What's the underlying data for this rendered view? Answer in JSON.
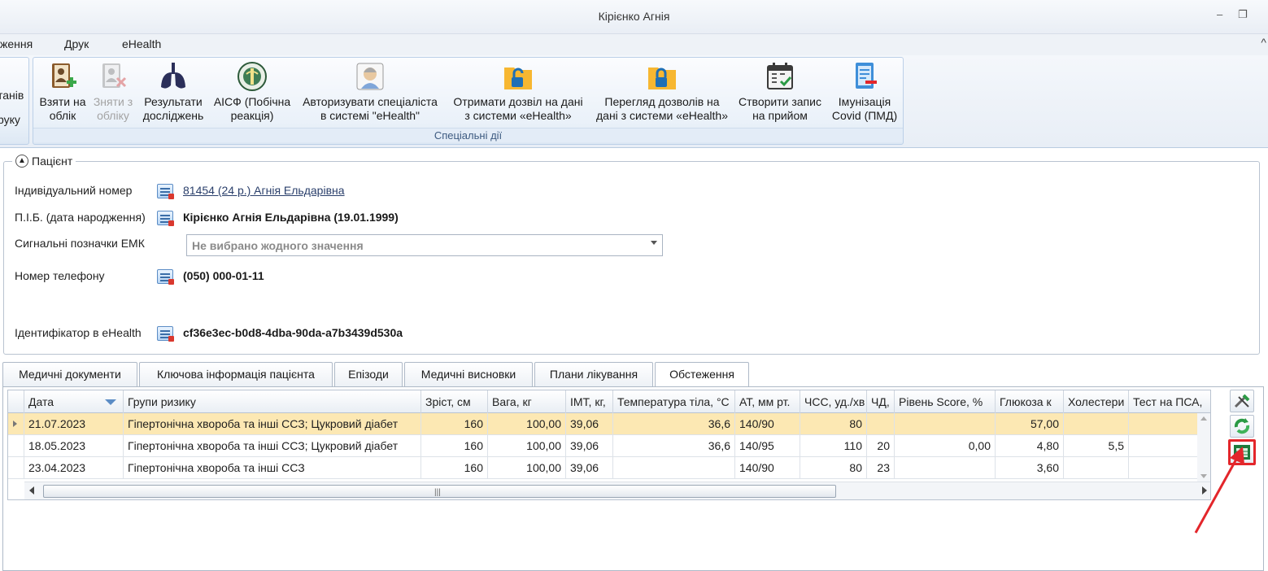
{
  "window": {
    "title": "Кірієнко Агнія",
    "minimize": "–",
    "restore": "❐"
  },
  "menu": {
    "items": [
      "ження",
      "Друк",
      "eHealth"
    ],
    "collapse": "^"
  },
  "ribbon": {
    "left_partial": {
      "line1": "танів",
      "line2": "руку"
    },
    "group_caption": "Спеціальні дії",
    "buttons": [
      {
        "line1": "Взяти на",
        "line2": "облік",
        "icon": "register-icon",
        "enabled": true
      },
      {
        "line1": "Зняти з",
        "line2": "обліку",
        "icon": "deregister-icon",
        "enabled": false
      },
      {
        "line1": "Результати",
        "line2": "досліджень",
        "icon": "lungs-icon",
        "enabled": true
      },
      {
        "line1": "АІСФ (Побічна",
        "line2": "реакція)",
        "icon": "emblem-icon",
        "enabled": true
      },
      {
        "line1": "Авторизувати спеціаліста",
        "line2": "в системі \"eHealth\"",
        "icon": "doctor-icon",
        "enabled": true
      },
      {
        "line1": "Отримати дозвіл на дані",
        "line2": "з системи «eHealth»",
        "icon": "unlock-folder-icon",
        "enabled": true
      },
      {
        "line1": "Перегляд дозволів на",
        "line2": "дані з системи «eHealth»",
        "icon": "lock-folder-icon",
        "enabled": true
      },
      {
        "line1": "Створити запис",
        "line2": "на прийом",
        "icon": "calendar-icon",
        "enabled": true
      },
      {
        "line1": "Імунізація",
        "line2": "Covid (ПМД)",
        "icon": "immunization-icon",
        "enabled": true
      }
    ]
  },
  "patient": {
    "legend": "Пацієнт",
    "id_label": "Індивідуальний номер",
    "id_value": "81454 (24 р.) Агнія Ельдарівна",
    "name_label": "П.І.Б. (дата народження)",
    "name_value": "Кірієнко Агнія Ельдарівна (19.01.1999)",
    "signal_label": "Сигнальні позначки ЕМК",
    "signal_placeholder": "Не вибрано жодного значення",
    "phone_label": "Номер телефону",
    "phone_value": "(050) 000-01-11",
    "ehealth_label": "Ідентифікатор в eHealth",
    "ehealth_value": "cf36e3ec-b0d8-4dba-90da-a7b3439d530a"
  },
  "tabs": [
    "Медичні документи",
    "Ключова інформація пацієнта",
    "Епізоди",
    "Медичні висновки",
    "Плани лікування",
    "Обстеження"
  ],
  "active_tab": "Обстеження",
  "table": {
    "columns": [
      "Дата",
      "Групи ризику",
      "Зріст, см",
      "Вага, кг",
      "ІМТ, кг,",
      "Температура тіла, °С",
      "АТ, мм рт.",
      "ЧСС, уд./хв",
      "ЧД,",
      "Рівень Score, %",
      "Глюкоза к",
      "Холестери",
      "Тест на ПСА,"
    ],
    "rows": [
      [
        "21.07.2023",
        "Гіпертонічна хвороба та інші ССЗ; Цукровий діабет",
        "160",
        "100,00",
        "39,06",
        "36,6",
        "140/90",
        "80",
        "",
        "",
        "57,00",
        "",
        ""
      ],
      [
        "18.05.2023",
        "Гіпертонічна хвороба та інші ССЗ; Цукровий діабет",
        "160",
        "100,00",
        "39,06",
        "36,6",
        "140/95",
        "110",
        "20",
        "0,00",
        "4,80",
        "5,5",
        ""
      ],
      [
        "23.04.2023",
        "Гіпертонічна хвороба та інші ССЗ",
        "160",
        "100,00",
        "39,06",
        "",
        "140/90",
        "80",
        "23",
        "",
        "3,60",
        "",
        ""
      ]
    ],
    "selected_row": 0
  },
  "side_tools": [
    "tools-icon",
    "refresh-icon",
    "excel-export-icon"
  ],
  "colors": {
    "selected_row": "#fce8b3",
    "highlight": "#e3262b",
    "accent": "#5b8cc5"
  }
}
